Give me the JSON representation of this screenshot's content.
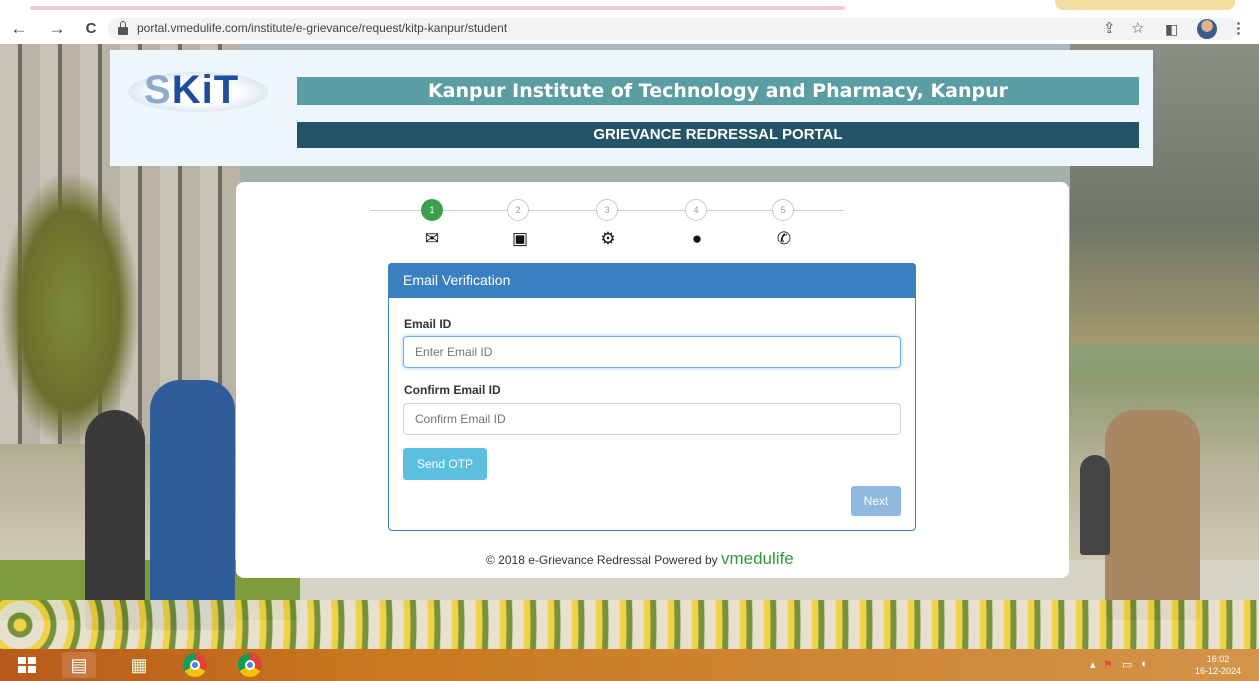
{
  "browser": {
    "url": "portal.vmedulife.com/institute/e-grievance/request/kitp-kanpur/student",
    "back": "←",
    "forward": "→",
    "reload": "C"
  },
  "header": {
    "logo_text": "KiT",
    "logo_mark": "S",
    "institute_title": "Kanpur Institute of Technology and Pharmacy, Kanpur",
    "portal_title": "GRIEVANCE REDRESSAL PORTAL"
  },
  "steps": [
    {
      "num": "1",
      "icon": "envelope-icon",
      "active": true
    },
    {
      "num": "2",
      "icon": "contact-book-icon",
      "active": false
    },
    {
      "num": "3",
      "icon": "gears-icon",
      "active": false
    },
    {
      "num": "4",
      "icon": "comment-icon",
      "active": false
    },
    {
      "num": "5",
      "icon": "phone-icon",
      "active": false
    }
  ],
  "form": {
    "panel_title": "Email Verification",
    "email_label": "Email ID",
    "email_placeholder": "Enter Email ID",
    "confirm_label": "Confirm Email ID",
    "confirm_placeholder": "Confirm Email ID",
    "send_otp": "Send OTP",
    "next": "Next"
  },
  "footer": {
    "text": "© 2018 e-Grievance Redressal Powered by",
    "brand": "vmedulife"
  },
  "taskbar": {
    "time": "16:02",
    "date": "16-12-2024"
  },
  "colors": {
    "title_bar": "#5a9ea3",
    "subtitle_bar": "#245465",
    "panel_header": "#3a7fc0",
    "active_step": "#3aa14a",
    "otp_button": "#5bc0de",
    "next_button": "#8fb8dd",
    "brand": "#2f9a3a"
  }
}
